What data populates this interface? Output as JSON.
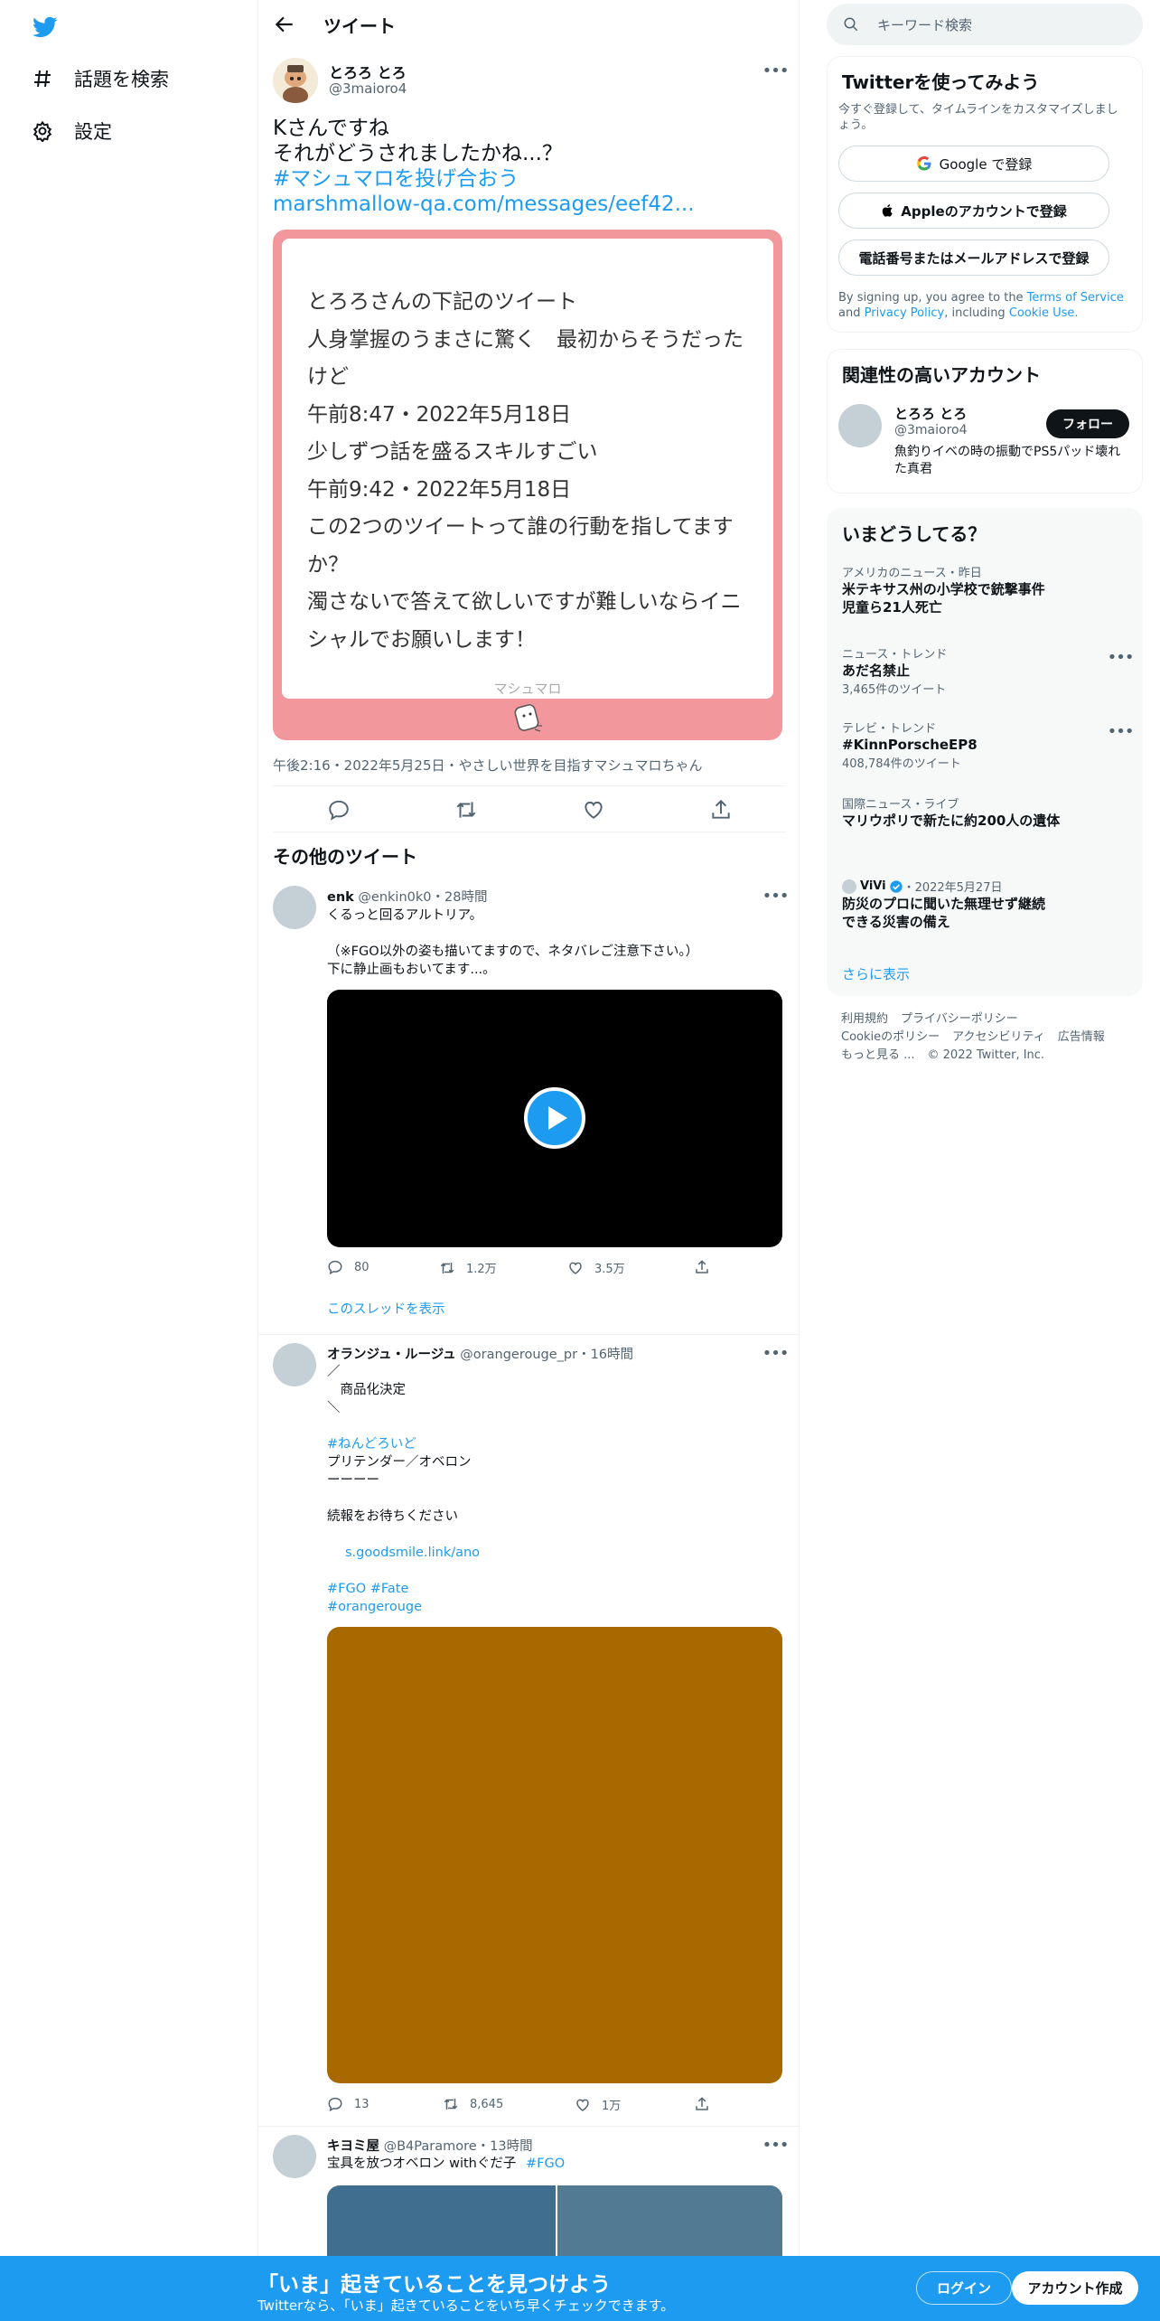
{
  "nav": {
    "explore_label": "話題を検索",
    "settings_label": "設定"
  },
  "header": {
    "title": "ツイート"
  },
  "tweet": {
    "author_name": "とろろ とろ",
    "author_handle": "@3maioro4",
    "lines": [
      "Kさんですね",
      "それがどうされましたかね...？"
    ],
    "hashtag": "#マシュマロを投げ合おう",
    "link": "marshmallow-qa.com/messages/eef42...",
    "card": {
      "lines": [
        "とろろさんの下記のツイート",
        "人身掌握のうまさに驚く　最初からそうだった",
        "けど",
        "午前8:47・2022年5月18日",
        "少しずつ話を盛るスキルすごい",
        "午前9:42・2022年5月18日",
        "この2つのツイートって誰の行動を指してます",
        "か？",
        "濁さないで答えて欲しいですが難しいならイニ",
        "シャルでお願いします！"
      ],
      "footer": "マシュマロ"
    },
    "meta": "午後2:16・2022年5月25日・やさしい世界を目指すマシュマロちゃん"
  },
  "more_tweets": {
    "title": "その他のツイート",
    "items": [
      {
        "name": "enk",
        "handle": "@enkin0k0",
        "time": "・28時間",
        "lines": [
          "くるっと回るアルトリア。",
          "",
          "（※FGO以外の姿も描いてますので、ネタバレご注意下さい。）",
          "下に静止画もおいてます...。"
        ],
        "replies": "80",
        "retweets": "1.2万",
        "likes": "3.5万",
        "thread_link": "このスレッドを表示"
      },
      {
        "name": "オランジュ・ルージュ",
        "handle": "@orangerouge_pr",
        "time": "・16時間",
        "lines": [
          "／",
          "　商品化決定",
          "＼"
        ],
        "hashtag1": "#ねんどろいど",
        "lines2": [
          "プリテンダー／オベロン",
          "ーーーー",
          "",
          "続報をお待ちください"
        ],
        "link": "s.goodsmile.link/ano",
        "hashtags2": "#FGO #Fate",
        "hashtags3": "#orangerouge",
        "replies": "13",
        "retweets": "8,645",
        "likes": "1万",
        "media_color": "#a86a00"
      },
      {
        "name": "キヨミ屋",
        "handle": "@B4Paramore",
        "time": "・13時間",
        "text": "宝具を放つオベロン withぐだ子",
        "hashtag": "#FGO"
      }
    ]
  },
  "right": {
    "search_placeholder": "キーワード検索",
    "signup": {
      "title": "Twitterを使ってみよう",
      "subtitle": "今すぐ登録して、タイムラインをカスタマイズしましょう。",
      "google": "Google で登録",
      "apple": "Appleのアカウントで登録",
      "phone": "電話番号またはメールアドレスで登録",
      "terms_pre": "By signing up, you agree to the",
      "terms_link": "Terms of Service",
      "and": "and",
      "privacy_link": "Privacy Policy",
      "including": ", including",
      "cookie_link": "Cookie Use."
    },
    "related": {
      "title": "関連性の高いアカウント",
      "name": "とろろ とろ",
      "handle": "@3maioro4",
      "bio": "魚釣りイベの時の振動でPS5パッド壊れた真君",
      "follow": "フォロー"
    },
    "trends": {
      "title": "いまどうしてる？",
      "items": [
        {
          "cat": "アメリカのニュース・昨日",
          "title": "米テキサス州の小学校で銃撃事件 児童ら21人死亡",
          "count": ""
        },
        {
          "cat": "ニュース・トレンド",
          "title": "あだ名禁止",
          "count": "3,465件のツイート"
        },
        {
          "cat": "テレビ・トレンド",
          "title": "#KinnPorscheEP8",
          "count": "408,784件のツイート"
        },
        {
          "cat": "国際ニュース・ライブ",
          "title": "マリウポリで新たに約200人の遺体",
          "count": ""
        },
        {
          "cat": "ViVi",
          "date": "・2022年5月27日",
          "title": "防災のプロに聞いた無理せず継続できる災害の備え",
          "count": ""
        }
      ],
      "show_more": "さらに表示"
    },
    "footer": [
      "利用規約",
      "プライバシーポリシー",
      "Cookieのポリシー",
      "アクセシビリティ",
      "広告情報",
      "もっと見る ...",
      "© 2022 Twitter, Inc."
    ]
  },
  "banner": {
    "title": "「いま」起きていることを見つけよう",
    "subtitle": "Twitterなら、「いま」起きていることをいち早くチェックできます。",
    "login": "ログイン",
    "signup": "アカウント作成"
  },
  "colors": {
    "accent": "#1d9bf0",
    "marshmallow_pink": "#f2989c"
  }
}
